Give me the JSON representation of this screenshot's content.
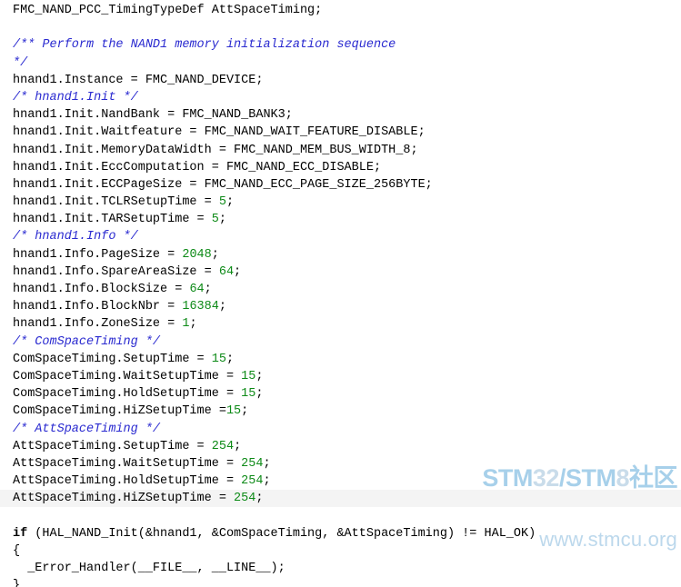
{
  "editor": {
    "language": "c",
    "background_color": "#ffffff",
    "highlight_line_color": "#f4f4f4",
    "comment_color": "#2a2ad0",
    "number_color": "#0d8a17",
    "text_color": "#000000",
    "highlighted_line_index": 27
  },
  "code": {
    "lines": [
      {
        "segments": [
          {
            "type": "plain",
            "text": "FMC_NAND_PCC_TimingTypeDef AttSpaceTiming;"
          }
        ]
      },
      {
        "segments": [
          {
            "type": "plain",
            "text": ""
          }
        ]
      },
      {
        "segments": [
          {
            "type": "comment",
            "text": "/** Perform the NAND1 memory initialization sequence"
          }
        ]
      },
      {
        "segments": [
          {
            "type": "comment",
            "text": "*/"
          }
        ]
      },
      {
        "segments": [
          {
            "type": "plain",
            "text": "hnand1.Instance = FMC_NAND_DEVICE;"
          }
        ]
      },
      {
        "segments": [
          {
            "type": "comment",
            "text": "/* hnand1.Init */"
          }
        ]
      },
      {
        "segments": [
          {
            "type": "plain",
            "text": "hnand1.Init.NandBank = FMC_NAND_BANK3;"
          }
        ]
      },
      {
        "segments": [
          {
            "type": "plain",
            "text": "hnand1.Init.Waitfeature = FMC_NAND_WAIT_FEATURE_DISABLE;"
          }
        ]
      },
      {
        "segments": [
          {
            "type": "plain",
            "text": "hnand1.Init.MemoryDataWidth = FMC_NAND_MEM_BUS_WIDTH_8;"
          }
        ]
      },
      {
        "segments": [
          {
            "type": "plain",
            "text": "hnand1.Init.EccComputation = FMC_NAND_ECC_DISABLE;"
          }
        ]
      },
      {
        "segments": [
          {
            "type": "plain",
            "text": "hnand1.Init.ECCPageSize = FMC_NAND_ECC_PAGE_SIZE_256BYTE;"
          }
        ]
      },
      {
        "segments": [
          {
            "type": "plain",
            "text": "hnand1.Init.TCLRSetupTime = "
          },
          {
            "type": "number",
            "text": "5"
          },
          {
            "type": "plain",
            "text": ";"
          }
        ]
      },
      {
        "segments": [
          {
            "type": "plain",
            "text": "hnand1.Init.TARSetupTime = "
          },
          {
            "type": "number",
            "text": "5"
          },
          {
            "type": "plain",
            "text": ";"
          }
        ]
      },
      {
        "segments": [
          {
            "type": "comment",
            "text": "/* hnand1.Info */"
          }
        ]
      },
      {
        "segments": [
          {
            "type": "plain",
            "text": "hnand1.Info.PageSize = "
          },
          {
            "type": "number",
            "text": "2048"
          },
          {
            "type": "plain",
            "text": ";"
          }
        ]
      },
      {
        "segments": [
          {
            "type": "plain",
            "text": "hnand1.Info.SpareAreaSize = "
          },
          {
            "type": "number",
            "text": "64"
          },
          {
            "type": "plain",
            "text": ";"
          }
        ]
      },
      {
        "segments": [
          {
            "type": "plain",
            "text": "hnand1.Info.BlockSize = "
          },
          {
            "type": "number",
            "text": "64"
          },
          {
            "type": "plain",
            "text": ";"
          }
        ]
      },
      {
        "segments": [
          {
            "type": "plain",
            "text": "hnand1.Info.BlockNbr = "
          },
          {
            "type": "number",
            "text": "16384"
          },
          {
            "type": "plain",
            "text": ";"
          }
        ]
      },
      {
        "segments": [
          {
            "type": "plain",
            "text": "hnand1.Info.ZoneSize = "
          },
          {
            "type": "number",
            "text": "1"
          },
          {
            "type": "plain",
            "text": ";"
          }
        ]
      },
      {
        "segments": [
          {
            "type": "comment",
            "text": "/* ComSpaceTiming */"
          }
        ]
      },
      {
        "segments": [
          {
            "type": "plain",
            "text": "ComSpaceTiming.SetupTime = "
          },
          {
            "type": "number",
            "text": "15"
          },
          {
            "type": "plain",
            "text": ";"
          }
        ]
      },
      {
        "segments": [
          {
            "type": "plain",
            "text": "ComSpaceTiming.WaitSetupTime = "
          },
          {
            "type": "number",
            "text": "15"
          },
          {
            "type": "plain",
            "text": ";"
          }
        ]
      },
      {
        "segments": [
          {
            "type": "plain",
            "text": "ComSpaceTiming.HoldSetupTime = "
          },
          {
            "type": "number",
            "text": "15"
          },
          {
            "type": "plain",
            "text": ";"
          }
        ]
      },
      {
        "segments": [
          {
            "type": "plain",
            "text": "ComSpaceTiming.HiZSetupTime ="
          },
          {
            "type": "number",
            "text": "15"
          },
          {
            "type": "plain",
            "text": ";"
          }
        ]
      },
      {
        "segments": [
          {
            "type": "comment",
            "text": "/* AttSpaceTiming */"
          }
        ]
      },
      {
        "segments": [
          {
            "type": "plain",
            "text": "AttSpaceTiming.SetupTime = "
          },
          {
            "type": "number",
            "text": "254"
          },
          {
            "type": "plain",
            "text": ";"
          }
        ]
      },
      {
        "segments": [
          {
            "type": "plain",
            "text": "AttSpaceTiming.WaitSetupTime = "
          },
          {
            "type": "number",
            "text": "254"
          },
          {
            "type": "plain",
            "text": ";"
          }
        ]
      },
      {
        "segments": [
          {
            "type": "plain",
            "text": "AttSpaceTiming.HoldSetupTime = "
          },
          {
            "type": "number",
            "text": "254"
          },
          {
            "type": "plain",
            "text": ";"
          }
        ]
      },
      {
        "highlight": true,
        "segments": [
          {
            "type": "plain",
            "text": "AttSpaceTiming.HiZSetupTime = "
          },
          {
            "type": "number",
            "text": "254"
          },
          {
            "type": "plain",
            "text": ";"
          }
        ]
      },
      {
        "segments": [
          {
            "type": "plain",
            "text": ""
          }
        ]
      },
      {
        "segments": [
          {
            "type": "keyword",
            "text": "if"
          },
          {
            "type": "plain",
            "text": " (HAL_NAND_Init(&hnand1, &ComSpaceTiming, &AttSpaceTiming) != HAL_OK)"
          }
        ]
      },
      {
        "segments": [
          {
            "type": "plain",
            "text": "{"
          }
        ]
      },
      {
        "segments": [
          {
            "type": "plain",
            "text": "  _Error_Handler(__FILE__, __LINE__);"
          }
        ]
      },
      {
        "segments": [
          {
            "type": "plain",
            "text": "}"
          }
        ]
      }
    ]
  },
  "watermark": {
    "brand_parts": [
      {
        "text": "STM",
        "style": "strong"
      },
      {
        "text": "32",
        "style": "light"
      },
      {
        "text": "/",
        "style": "strong"
      },
      {
        "text": "STM",
        "style": "strong"
      },
      {
        "text": "8",
        "style": "light"
      },
      {
        "text": "社区",
        "style": "cjk"
      }
    ],
    "url": "www.stmcu.org",
    "strong_color": "#a7d0ea",
    "light_color": "#c9dcea",
    "url_color": "#bcd8ec"
  }
}
